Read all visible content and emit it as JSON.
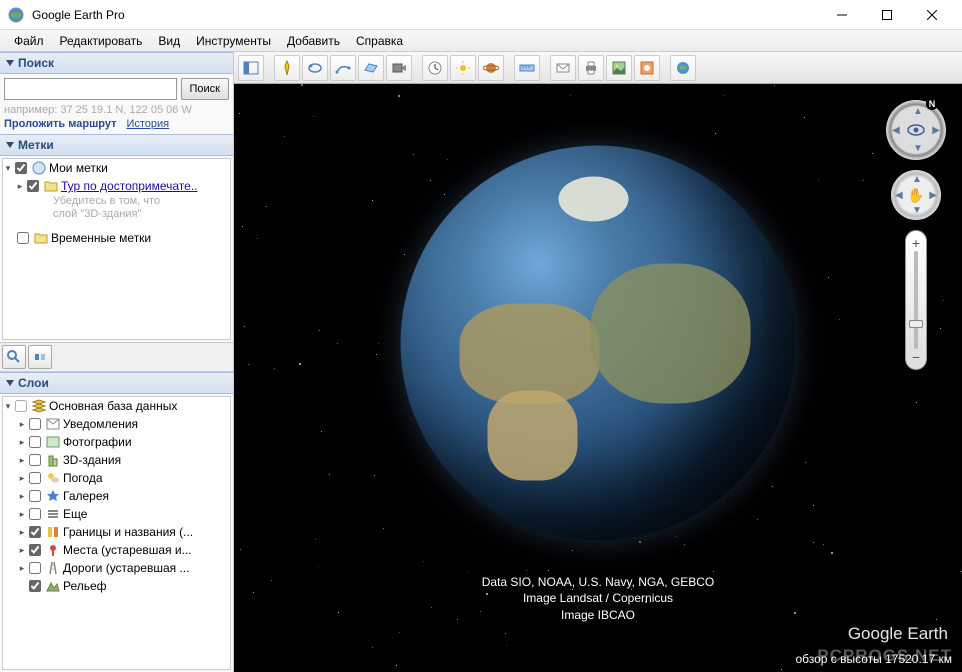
{
  "window": {
    "title": "Google Earth Pro"
  },
  "menu": {
    "file": "Файл",
    "edit": "Редактировать",
    "view": "Вид",
    "tools": "Инструменты",
    "add": "Добавить",
    "help": "Справка"
  },
  "search": {
    "panel_title": "Поиск",
    "button": "Поиск",
    "hint": "например: 37 25 19.1 N, 122 05 06 W",
    "route_link": "Проложить маршрут",
    "history_link": "История"
  },
  "marks": {
    "panel_title": "Метки",
    "my_marks": "Мои метки",
    "tour_link": "Тур по достопримечате..",
    "tour_hint1": "Убедитесь в том, что",
    "tour_hint2": "слой \"3D-здания\"",
    "temp_marks": "Временные метки"
  },
  "layers": {
    "panel_title": "Слои",
    "root": "Основная база данных",
    "items": [
      {
        "label": "Уведомления",
        "checked": false,
        "icon": "mail"
      },
      {
        "label": "Фотографии",
        "checked": false,
        "icon": "photo"
      },
      {
        "label": "3D-здания",
        "checked": false,
        "icon": "building"
      },
      {
        "label": "Погода",
        "checked": false,
        "icon": "weather"
      },
      {
        "label": "Галерея",
        "checked": false,
        "icon": "star"
      },
      {
        "label": "Еще",
        "checked": false,
        "icon": "more"
      },
      {
        "label": "Границы и названия (...",
        "checked": true,
        "icon": "borders"
      },
      {
        "label": "Места (устаревшая и...",
        "checked": true,
        "icon": "places"
      },
      {
        "label": "Дороги (устаревшая ...",
        "checked": false,
        "icon": "roads"
      },
      {
        "label": "Рельеф",
        "checked": true,
        "icon": "terrain"
      }
    ]
  },
  "toolbar_icons": [
    "hide-sidebar",
    "pin",
    "polygon",
    "path",
    "image-overlay",
    "record",
    "time-history",
    "sun",
    "planet",
    "ruler",
    "email",
    "print",
    "save-image",
    "kml",
    "view-earth"
  ],
  "credits": {
    "line1": "Data SIO, NOAA, U.S. Navy, NGA, GEBCO",
    "line2": "Image Landsat / Copernicus",
    "line3": "Image IBCAO"
  },
  "logo": "Google Earth",
  "status": "обзор с высоты 17520.17 км",
  "watermark": "PCPROGS.NET",
  "compass_n": "N"
}
